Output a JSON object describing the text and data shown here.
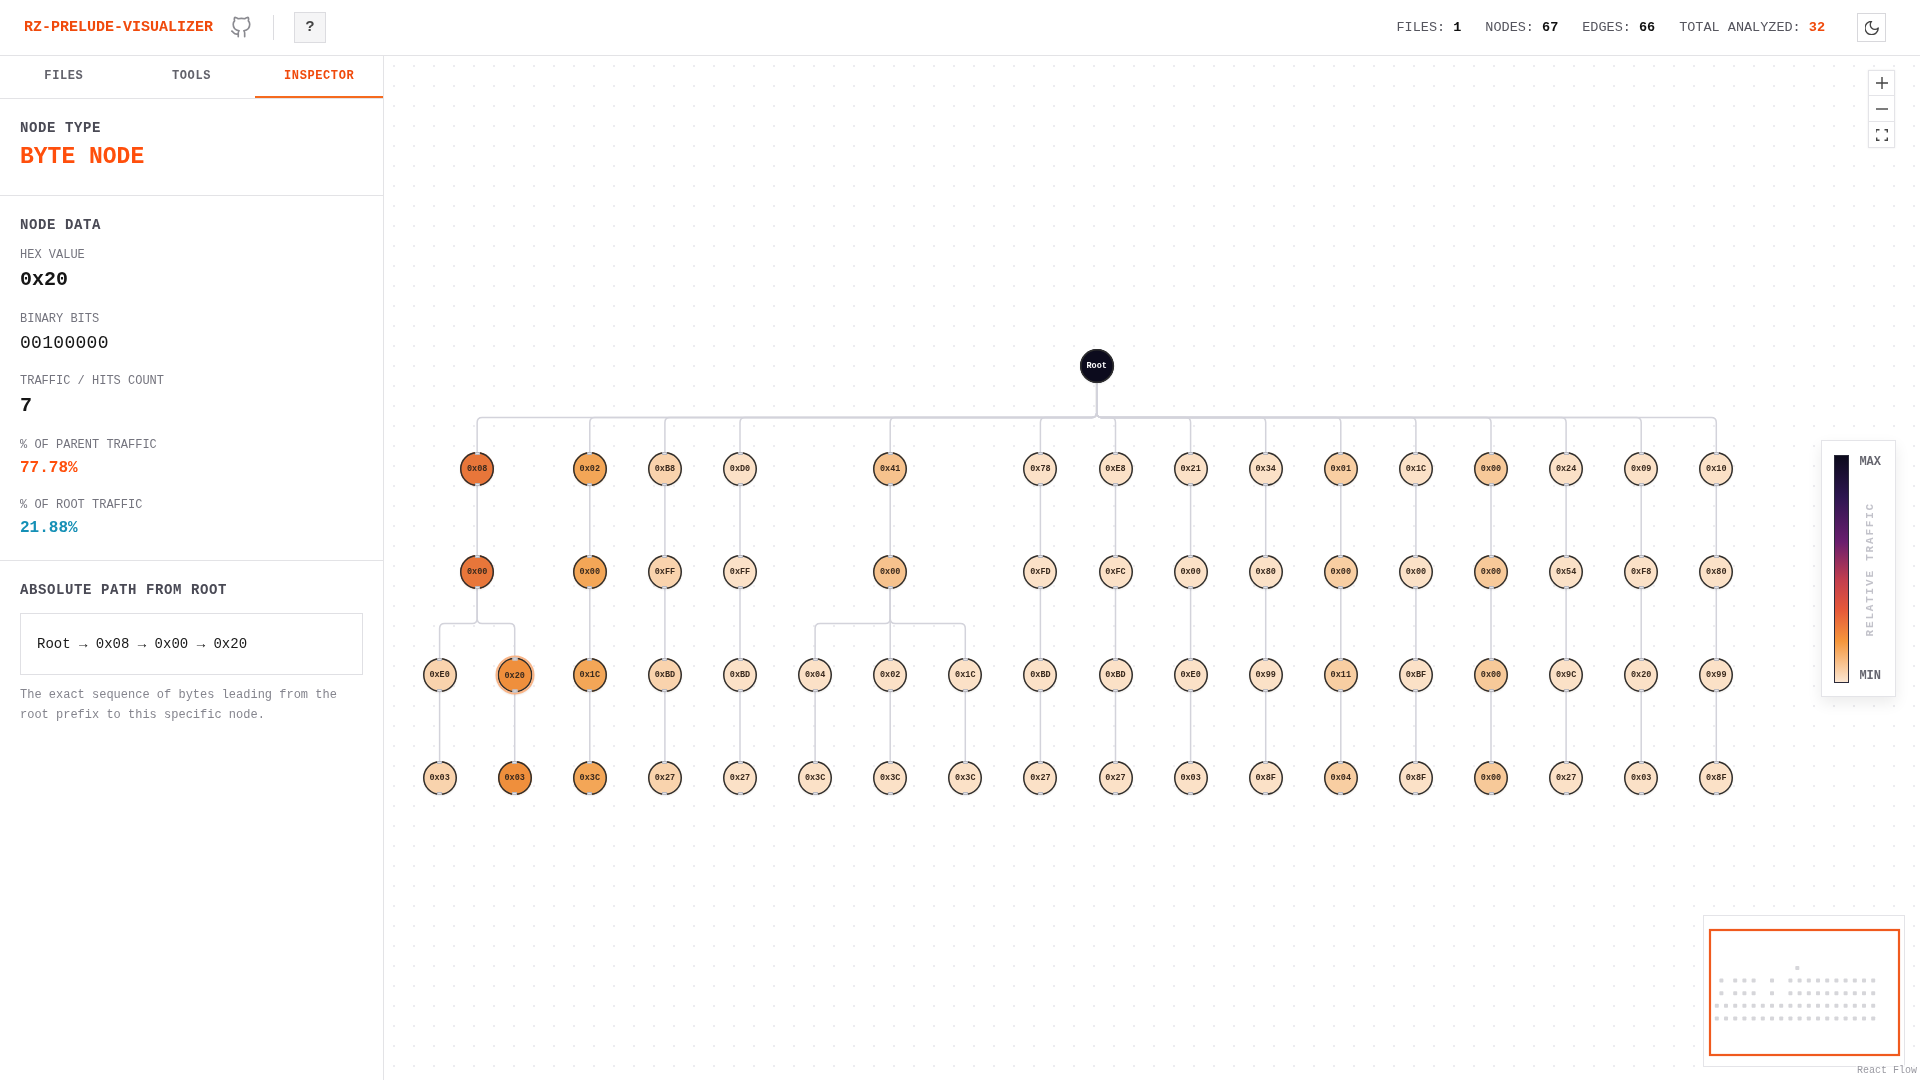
{
  "header": {
    "title": "RZ-PRELUDE-VISUALIZER",
    "help_button": "?",
    "stats": [
      {
        "label": "FILES:",
        "value": "1",
        "accent": false
      },
      {
        "label": "NODES:",
        "value": "67",
        "accent": false
      },
      {
        "label": "EDGES:",
        "value": "66",
        "accent": false
      },
      {
        "label": "TOTAL ANALYZED:",
        "value": "32",
        "accent": true
      }
    ]
  },
  "sidebar": {
    "tabs": [
      {
        "label": "FILES",
        "selected": false
      },
      {
        "label": "TOOLS",
        "selected": false
      },
      {
        "label": "INSPECTOR",
        "selected": true
      }
    ],
    "node_type": {
      "heading": "NODE TYPE",
      "value": "BYTE NODE"
    },
    "node_data": {
      "heading": "NODE DATA",
      "fields": [
        {
          "label": "HEX VALUE",
          "value": "0x20",
          "kind": "hex"
        },
        {
          "label": "BINARY BITS",
          "value": "00100000",
          "kind": "bits"
        },
        {
          "label": "TRAFFIC / HITS COUNT",
          "value": "7",
          "kind": "count"
        },
        {
          "label": "% OF PARENT TRAFFIC",
          "value": "77.78%",
          "kind": "parent_share"
        },
        {
          "label": "% OF ROOT TRAFFIC",
          "value": "21.88%",
          "kind": "root_share"
        }
      ]
    },
    "path": {
      "heading": "ABSOLUTE PATH FROM ROOT",
      "value": "Root → 0x08 → 0x00 → 0x20",
      "description": "The exact sequence of bytes leading from the root prefix to this specific node."
    }
  },
  "graph": {
    "root": {
      "label": "Root",
      "color": "#0c0b1d",
      "selected": false,
      "children": [
        {
          "label": "0x08",
          "color": "#e8763a",
          "selected": false,
          "children": [
            {
              "label": "0x00",
              "color": "#e8763a",
              "selected": false,
              "children": [
                {
                  "label": "0xE0",
                  "color": "#f9d3ad",
                  "selected": false,
                  "children": [
                    {
                      "label": "0x03",
                      "color": "#f9d3ad",
                      "selected": false
                    }
                  ]
                },
                {
                  "label": "0x20",
                  "color": "#ef8f3c",
                  "selected": true,
                  "children": [
                    {
                      "label": "0x03",
                      "color": "#ef8f3c",
                      "selected": false
                    }
                  ]
                }
              ]
            }
          ]
        },
        {
          "label": "0x02",
          "color": "#f3a657",
          "selected": false,
          "children": [
            {
              "label": "0x00",
              "color": "#f3a657",
              "selected": false,
              "children": [
                {
                  "label": "0x1C",
                  "color": "#f3a657",
                  "selected": false,
                  "children": [
                    {
                      "label": "0x3C",
                      "color": "#f3a657",
                      "selected": false
                    }
                  ]
                }
              ]
            }
          ]
        },
        {
          "label": "0xB8",
          "color": "#f9d3ad",
          "selected": false,
          "children": [
            {
              "label": "0xFF",
              "color": "#f9d3ad",
              "selected": false,
              "children": [
                {
                  "label": "0xBD",
                  "color": "#f9d3ad",
                  "selected": false,
                  "children": [
                    {
                      "label": "0x27",
                      "color": "#f9d3ad",
                      "selected": false
                    }
                  ]
                }
              ]
            }
          ]
        },
        {
          "label": "0xD0",
          "color": "#fbe1c7",
          "selected": false,
          "children": [
            {
              "label": "0xFF",
              "color": "#fbe1c7",
              "selected": false,
              "children": [
                {
                  "label": "0xBD",
                  "color": "#fbe1c7",
                  "selected": false,
                  "children": [
                    {
                      "label": "0x27",
                      "color": "#fbe1c7",
                      "selected": false
                    }
                  ]
                }
              ]
            }
          ]
        },
        {
          "label": "0x41",
          "color": "#f6c28d",
          "selected": false,
          "children": [
            {
              "label": "0x00",
              "color": "#f6c28d",
              "selected": false,
              "children": [
                {
                  "label": "0x04",
                  "color": "#fbe1c7",
                  "selected": false,
                  "children": [
                    {
                      "label": "0x3C",
                      "color": "#fbe1c7",
                      "selected": false
                    }
                  ]
                },
                {
                  "label": "0x02",
                  "color": "#fbe1c7",
                  "selected": false,
                  "children": [
                    {
                      "label": "0x3C",
                      "color": "#fbe1c7",
                      "selected": false
                    }
                  ]
                },
                {
                  "label": "0x1C",
                  "color": "#fbe1c7",
                  "selected": false,
                  "children": [
                    {
                      "label": "0x3C",
                      "color": "#fbe1c7",
                      "selected": false
                    }
                  ]
                }
              ]
            }
          ]
        },
        {
          "label": "0x78",
          "color": "#fbe1c7",
          "selected": false,
          "children": [
            {
              "label": "0xFD",
              "color": "#fbe1c7",
              "selected": false,
              "children": [
                {
                  "label": "0xBD",
                  "color": "#fbe1c7",
                  "selected": false,
                  "children": [
                    {
                      "label": "0x27",
                      "color": "#fbe1c7",
                      "selected": false
                    }
                  ]
                }
              ]
            }
          ]
        },
        {
          "label": "0xE8",
          "color": "#fbe1c7",
          "selected": false,
          "children": [
            {
              "label": "0xFC",
              "color": "#fbe1c7",
              "selected": false,
              "children": [
                {
                  "label": "0xBD",
                  "color": "#fbe1c7",
                  "selected": false,
                  "children": [
                    {
                      "label": "0x27",
                      "color": "#fbe1c7",
                      "selected": false
                    }
                  ]
                }
              ]
            }
          ]
        },
        {
          "label": "0x21",
          "color": "#fbe1c7",
          "selected": false,
          "children": [
            {
              "label": "0x00",
              "color": "#fbe1c7",
              "selected": false,
              "children": [
                {
                  "label": "0xE0",
                  "color": "#fbe1c7",
                  "selected": false,
                  "children": [
                    {
                      "label": "0x03",
                      "color": "#fbe1c7",
                      "selected": false
                    }
                  ]
                }
              ]
            }
          ]
        },
        {
          "label": "0x34",
          "color": "#fbe1c7",
          "selected": false,
          "children": [
            {
              "label": "0x80",
              "color": "#fbe1c7",
              "selected": false,
              "children": [
                {
                  "label": "0x99",
                  "color": "#fbe1c7",
                  "selected": false,
                  "children": [
                    {
                      "label": "0x8F",
                      "color": "#fbe1c7",
                      "selected": false
                    }
                  ]
                }
              ]
            }
          ]
        },
        {
          "label": "0x01",
          "color": "#f8cea2",
          "selected": false,
          "children": [
            {
              "label": "0x00",
              "color": "#f8cea2",
              "selected": false,
              "children": [
                {
                  "label": "0x11",
                  "color": "#f8cea2",
                  "selected": false,
                  "children": [
                    {
                      "label": "0x04",
                      "color": "#f8cea2",
                      "selected": false
                    }
                  ]
                }
              ]
            }
          ]
        },
        {
          "label": "0x1C",
          "color": "#fbe1c7",
          "selected": false,
          "children": [
            {
              "label": "0x00",
              "color": "#fbe1c7",
              "selected": false,
              "children": [
                {
                  "label": "0xBF",
                  "color": "#fbe1c7",
                  "selected": false,
                  "children": [
                    {
                      "label": "0x8F",
                      "color": "#fbe1c7",
                      "selected": false
                    }
                  ]
                }
              ]
            }
          ]
        },
        {
          "label": "0x00",
          "color": "#f7c999",
          "selected": false,
          "children": [
            {
              "label": "0x00",
              "color": "#f7c999",
              "selected": false,
              "children": [
                {
                  "label": "0x00",
                  "color": "#f7c999",
                  "selected": false,
                  "children": [
                    {
                      "label": "0x00",
                      "color": "#f7c999",
                      "selected": false
                    }
                  ]
                }
              ]
            }
          ]
        },
        {
          "label": "0x24",
          "color": "#fbe1c7",
          "selected": false,
          "children": [
            {
              "label": "0x54",
              "color": "#fbe1c7",
              "selected": false,
              "children": [
                {
                  "label": "0x9C",
                  "color": "#fbe1c7",
                  "selected": false,
                  "children": [
                    {
                      "label": "0x27",
                      "color": "#fbe1c7",
                      "selected": false
                    }
                  ]
                }
              ]
            }
          ]
        },
        {
          "label": "0x09",
          "color": "#fbe1c7",
          "selected": false,
          "children": [
            {
              "label": "0xF8",
              "color": "#fbe1c7",
              "selected": false,
              "children": [
                {
                  "label": "0x20",
                  "color": "#fbe1c7",
                  "selected": false,
                  "children": [
                    {
                      "label": "0x03",
                      "color": "#fbe1c7",
                      "selected": false
                    }
                  ]
                }
              ]
            }
          ]
        },
        {
          "label": "0x10",
          "color": "#fbe1c7",
          "selected": false,
          "children": [
            {
              "label": "0x80",
              "color": "#fbe1c7",
              "selected": false,
              "children": [
                {
                  "label": "0x99",
                  "color": "#fbe1c7",
                  "selected": false,
                  "children": [
                    {
                      "label": "0x8F",
                      "color": "#fbe1c7",
                      "selected": false
                    }
                  ]
                }
              ]
            }
          ]
        }
      ]
    },
    "legend": {
      "max": "MAX",
      "title": "RELATIVE TRAFFIC",
      "min": "MIN"
    },
    "attribution": "React Flow"
  }
}
